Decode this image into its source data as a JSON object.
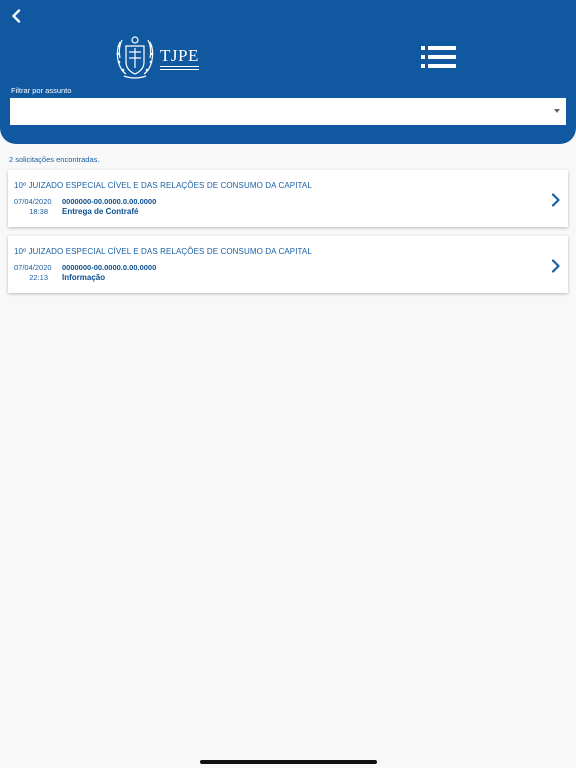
{
  "header": {
    "back_icon": "chevron-left-icon",
    "logo_text": "TJPE",
    "menu_icon": "list-menu-icon",
    "background_color": "#1058a0"
  },
  "filter": {
    "label": "Filtrar por assunto",
    "selected_value": ""
  },
  "results": {
    "count_text": "2 solicitações encontradas.",
    "items": [
      {
        "court": "10º JUIZADO ESPECIAL CÍVEL E DAS RELAÇÕES DE CONSUMO DA CAPITAL",
        "date": "07/04/2020",
        "time": "18:38",
        "process": "0000000-00.0000.0.00.0000",
        "subject": "Entrega de Contrafé"
      },
      {
        "court": "10º JUIZADO ESPECIAL CÍVEL E DAS RELAÇÕES DE CONSUMO DA CAPITAL",
        "date": "07/04/2020",
        "time": "22:13",
        "process": "0000000-00.0000.0.00.0000",
        "subject": "Informação"
      }
    ]
  },
  "colors": {
    "accent": "#1a5fa3",
    "page_background": "#f8f8f8"
  }
}
